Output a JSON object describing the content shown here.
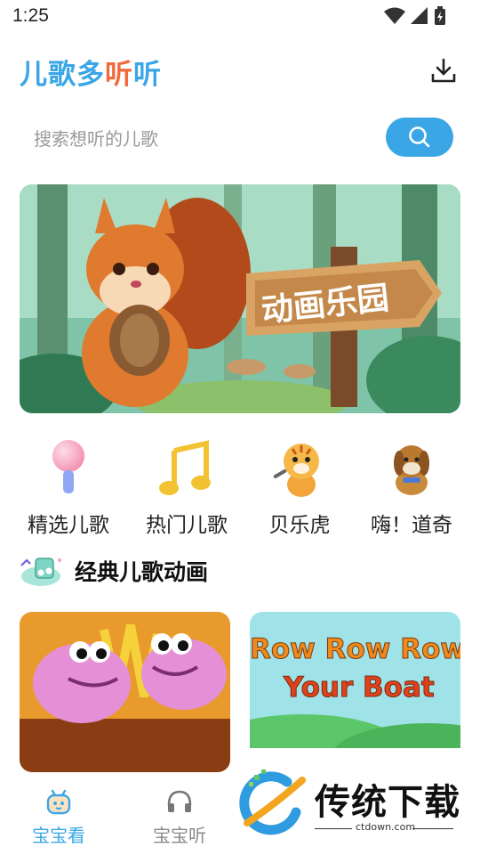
{
  "status_bar": {
    "time": "1:25"
  },
  "header": {
    "title_part_1": "儿歌多",
    "title_part_2": "听",
    "title_part_3": "听"
  },
  "search": {
    "placeholder": "搜索想听的儿歌"
  },
  "banner": {
    "text": "动画乐园"
  },
  "categories": [
    {
      "label": "精选儿歌",
      "icon": "microphone-icon"
    },
    {
      "label": "热门儿歌",
      "icon": "music-note-icon"
    },
    {
      "label": "贝乐虎",
      "icon": "tiger-icon"
    },
    {
      "label": "嗨！道奇",
      "icon": "dog-icon"
    }
  ],
  "section": {
    "title": "经典儿歌动画",
    "icon": "music-cloud-icon"
  },
  "videos": [
    {
      "thumbnail": "fish-cartoon"
    },
    {
      "line1": "Row Row Row",
      "line2": "Your Boat"
    }
  ],
  "bottom_nav": [
    {
      "label": "宝宝看",
      "icon": "baby-robot-icon",
      "active": true
    },
    {
      "label": "宝宝听",
      "icon": "headphones-icon",
      "active": false
    }
  ],
  "watermark": {
    "text": "传统下载",
    "domain": "ctdown.com"
  },
  "colors": {
    "accent": "#3aa6e6",
    "brand_orange": "#f06a3c"
  }
}
